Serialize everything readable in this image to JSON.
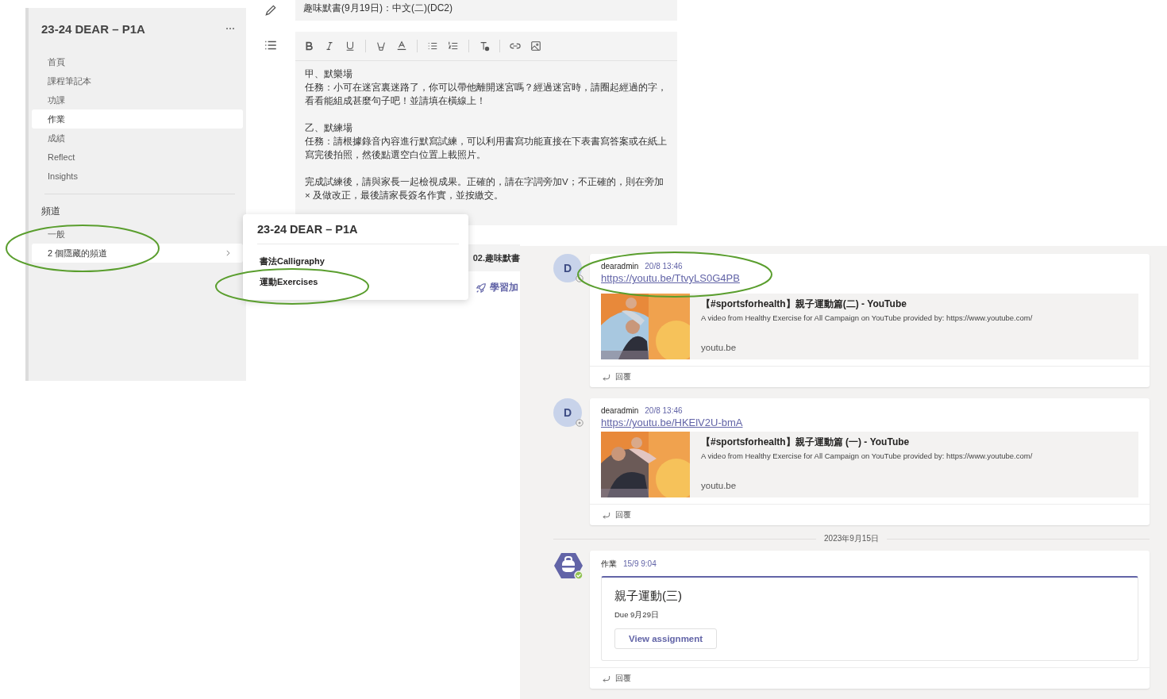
{
  "sidebar": {
    "title": "23-24 DEAR – P1A",
    "items": [
      {
        "label": "首頁",
        "selected": false
      },
      {
        "label": "課程筆記本",
        "selected": false
      },
      {
        "label": "功課",
        "selected": false
      },
      {
        "label": "作業",
        "selected": true
      },
      {
        "label": "成績",
        "selected": false
      },
      {
        "label": "Reflect",
        "selected": false
      },
      {
        "label": "Insights",
        "selected": false
      }
    ],
    "channels_heading": "頻道",
    "channels": [
      {
        "label": "一般",
        "selected": false,
        "kind": "channel"
      },
      {
        "label": "2 個隱藏的頻道",
        "selected": true,
        "kind": "hidden"
      }
    ]
  },
  "assignment": {
    "title": "趣味默書(9月19日)：中文(二)(DC2)",
    "paragraphs": [
      {
        "heading": "甲、默樂場",
        "text": "任務：小可在迷宮裏迷路了，你可以帶他離開迷宮嗎？經過迷宮時，請圈起經過的字，看看能組成甚麼句子吧！並請填在橫線上！"
      },
      {
        "heading": "乙、默練場",
        "text": "任務：請根據錄音內容進行默寫試練，可以利用書寫功能直接在下表書寫答案或在紙上寫完後拍照，然後點選空白位置上載照片。"
      },
      {
        "text": "完成試練後，請與家長一起檢視成果。正確的，請在字詞旁加V；不正確的，則在旁加 × 及做改正，最後請家長簽名作實，並按繳交。"
      }
    ],
    "next_field": "02.趣味默書",
    "action": "學習加"
  },
  "popup": {
    "title": "23-24 DEAR – P1A",
    "channels": [
      {
        "label": "書法Calligraphy"
      },
      {
        "label": "運動Exercises"
      }
    ]
  },
  "chat": {
    "items": [
      {
        "kind": "link",
        "avatar": "D",
        "author": "dearadmin",
        "time": "20/8 13:46",
        "link": "https://youtu.be/TtvyLS0G4PB",
        "preview": {
          "title": "【#sportsforhealth】親子運動篇(二) - YouTube",
          "description": "A video from Healthy Exercise for All Campaign on YouTube provided by: https://www.youtube.com/",
          "domain": "youtu.be"
        },
        "reply": "回覆"
      },
      {
        "kind": "link",
        "avatar": "D",
        "author": "dearadmin",
        "time": "20/8 13:46",
        "link": "https://youtu.be/HKElV2U-bmA",
        "preview": {
          "title": "【#sportsforhealth】親子運動篇 (一) - YouTube",
          "description": "A video from Healthy Exercise for All Campaign on YouTube provided by: https://www.youtube.com/",
          "domain": "youtu.be"
        },
        "reply": "回覆"
      },
      {
        "kind": "divider",
        "text": "2023年9月15日"
      },
      {
        "kind": "assignment",
        "author": "作業",
        "time": "15/9 9:04",
        "card": {
          "title": "親子運動(三)",
          "due": "Due 9月29日",
          "button": "View assignment"
        },
        "reply": "回覆"
      }
    ]
  }
}
